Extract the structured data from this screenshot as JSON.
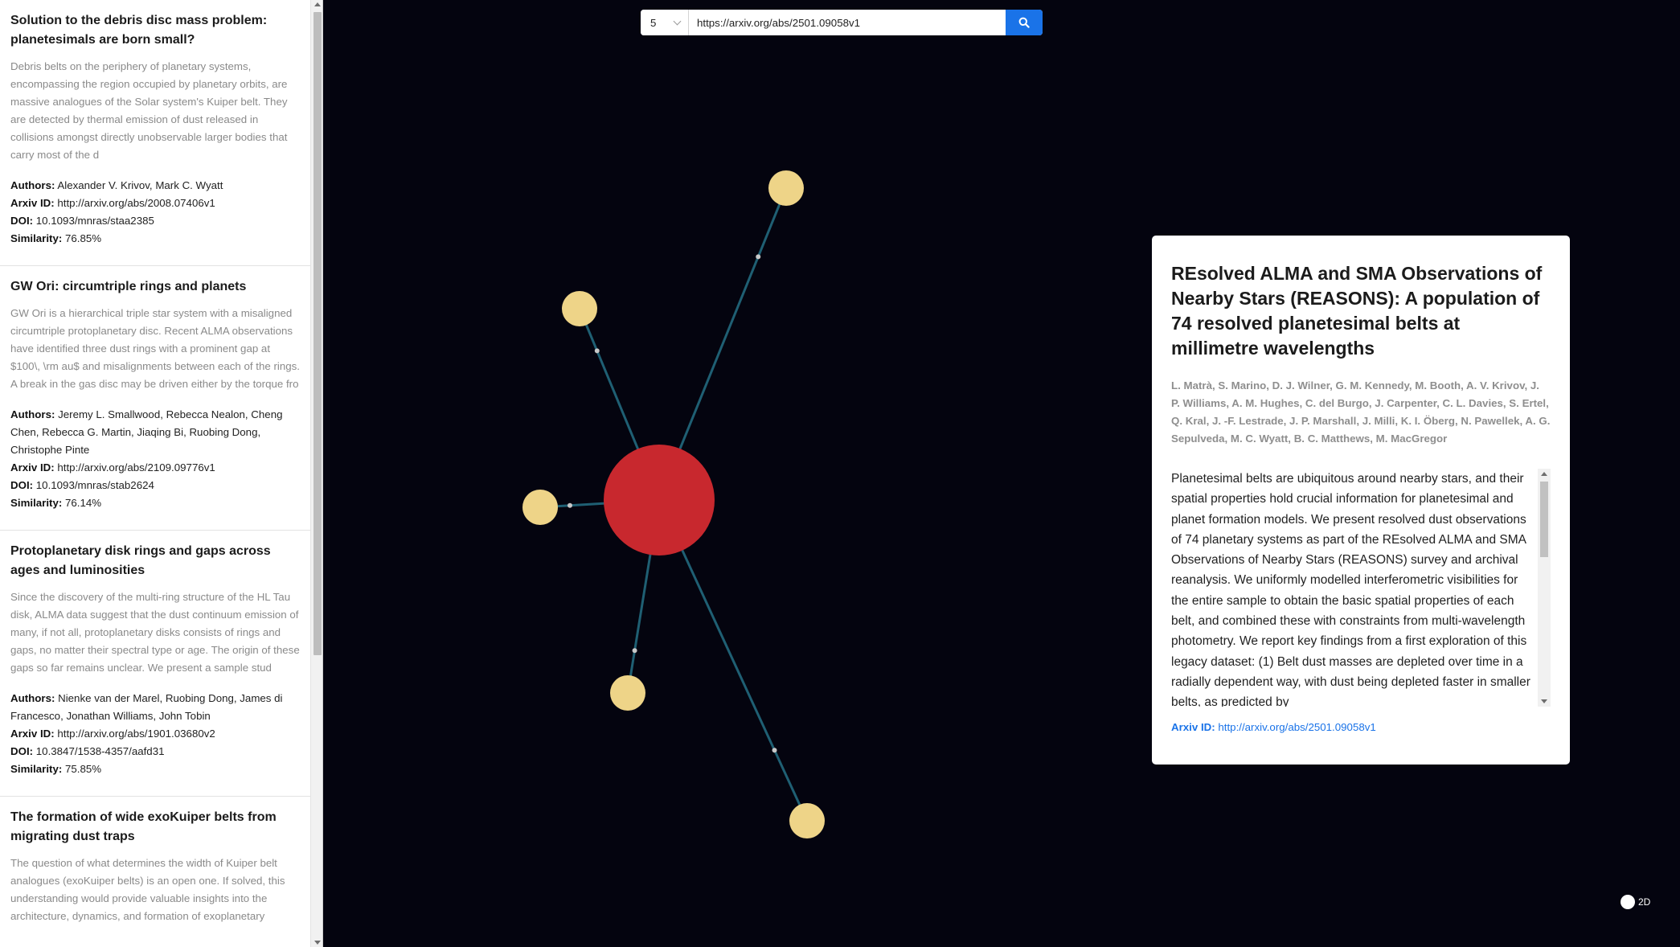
{
  "search": {
    "count_value": "5",
    "url_value": "https://arxiv.org/abs/2501.09058v1",
    "button_icon": "search-icon"
  },
  "sidebar": {
    "results": [
      {
        "title": "Solution to the debris disc mass problem: planetesimals are born small?",
        "abstract": "Debris belts on the periphery of planetary systems, encompassing the region occupied by planetary orbits, are massive analogues of the Solar system's Kuiper belt. They are detected by thermal emission of dust released in collisions amongst directly unobservable larger bodies that carry most of the d",
        "authors": "Alexander V. Krivov, Mark C. Wyatt",
        "arxiv_id": "http://arxiv.org/abs/2008.07406v1",
        "doi": "10.1093/mnras/staa2385",
        "similarity": "76.85%"
      },
      {
        "title": "GW Ori: circumtriple rings and planets",
        "abstract": "GW Ori is a hierarchical triple star system with a misaligned circumtriple protoplanetary disc. Recent ALMA observations have identified three dust rings with a prominent gap at $100\\, \\rm au$ and misalignments between each of the rings. A break in the gas disc may be driven either by the torque fro",
        "authors": "Jeremy L. Smallwood, Rebecca Nealon, Cheng Chen, Rebecca G. Martin, Jiaqing Bi, Ruobing Dong, Christophe Pinte",
        "arxiv_id": "http://arxiv.org/abs/2109.09776v1",
        "doi": "10.1093/mnras/stab2624",
        "similarity": "76.14%"
      },
      {
        "title": "Protoplanetary disk rings and gaps across ages and luminosities",
        "abstract": "Since the discovery of the multi-ring structure of the HL Tau disk, ALMA data suggest that the dust continuum emission of many, if not all, protoplanetary disks consists of rings and gaps, no matter their spectral type or age. The origin of these gaps so far remains unclear. We present a sample stud",
        "authors": "Nienke van der Marel, Ruobing Dong, James di Francesco, Jonathan Williams, John Tobin",
        "arxiv_id": "http://arxiv.org/abs/1901.03680v2",
        "doi": "10.3847/1538-4357/aafd31",
        "similarity": "75.85%"
      },
      {
        "title": "The formation of wide exoKuiper belts from migrating dust traps",
        "abstract": "The question of what determines the width of Kuiper belt analogues (exoKuiper belts) is an open one. If solved, this understanding would provide valuable insights into the architecture, dynamics, and formation of exoplanetary",
        "authors": "",
        "arxiv_id": "",
        "doi": "",
        "similarity": ""
      }
    ],
    "labels": {
      "authors": "Authors:",
      "arxiv_id": "Arxiv ID:",
      "doi": "DOI:",
      "similarity": "Similarity:"
    }
  },
  "detail": {
    "title": "REsolved ALMA and SMA Observations of Nearby Stars (REASONS): A population of 74 resolved planetesimal belts at millimetre wavelengths",
    "authors": "L. Matrà, S. Marino, D. J. Wilner, G. M. Kennedy, M. Booth, A. V. Krivov, J. P. Williams, A. M. Hughes, C. del Burgo, J. Carpenter, C. L. Davies, S. Ertel, Q. Kral, J. -F. Lestrade, J. P. Marshall, J. Milli, K. I. Öberg, N. Pawellek, A. G. Sepulveda, M. C. Wyatt, B. C. Matthews, M. MacGregor",
    "abstract": "Planetesimal belts are ubiquitous around nearby stars, and their spatial properties hold crucial information for planetesimal and planet formation models. We present resolved dust observations of 74 planetary systems as part of the REsolved ALMA and SMA Observations of Nearby Stars (REASONS) survey and archival reanalysis. We uniformly modelled interferometric visibilities for the entire sample to obtain the basic spatial properties of each belt, and combined these with constraints from multi-wavelength photometry. We report key findings from a first exploration of this legacy dataset: (1) Belt dust masses are depleted over time in a radially dependent way, with dust being depleted faster in smaller belts, as predicted by",
    "arxiv_label": "Arxiv ID:",
    "arxiv_link": "http://arxiv.org/abs/2501.09058v1"
  },
  "graph": {
    "center_color": "#c8282e",
    "node_color": "#eed488",
    "link_color": "#1f5f73",
    "particle_color": "#c8c8c8",
    "node_count": 6
  },
  "toggle": {
    "label": "2D"
  }
}
